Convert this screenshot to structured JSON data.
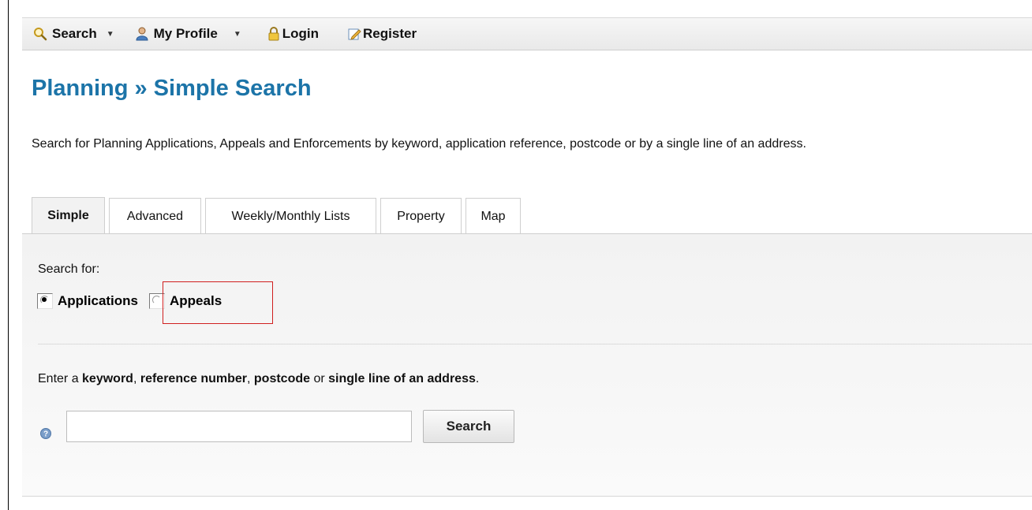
{
  "toolbar": {
    "items": [
      {
        "label": "Search",
        "icon": "magnifier-icon",
        "has_dropdown": true
      },
      {
        "label": "My Profile",
        "icon": "user-icon",
        "has_dropdown": true
      },
      {
        "label": "Login",
        "icon": "lock-icon",
        "has_dropdown": false
      },
      {
        "label": "Register",
        "icon": "edit-icon",
        "has_dropdown": false
      }
    ]
  },
  "page": {
    "title": "Planning » Simple Search",
    "intro": "Search for Planning Applications, Appeals and Enforcements by keyword, application reference, postcode or by a single line of an address."
  },
  "tabs": [
    {
      "label": "Simple",
      "active": true
    },
    {
      "label": "Advanced",
      "active": false
    },
    {
      "label": "Weekly/Monthly Lists",
      "active": false
    },
    {
      "label": "Property",
      "active": false
    },
    {
      "label": "Map",
      "active": false
    }
  ],
  "search": {
    "search_for_label": "Search for:",
    "options": [
      {
        "label": "Applications",
        "checked": true
      },
      {
        "label": "Appeals",
        "checked": false
      }
    ],
    "instruction": {
      "t1": "Enter a ",
      "b1": "keyword",
      "t2": ", ",
      "b2": "reference number",
      "t3": ", ",
      "b3": "postcode",
      "t4": " or ",
      "b4": "single line of an address",
      "t5": "."
    },
    "input_value": "",
    "button_label": "Search"
  },
  "colors": {
    "title": "#1c74a8",
    "highlight_border": "#d01f1f"
  }
}
